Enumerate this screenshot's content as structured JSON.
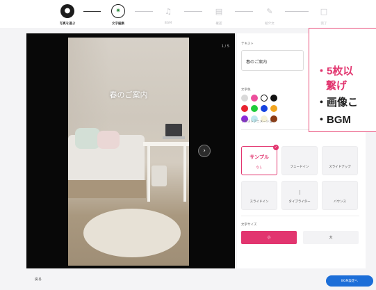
{
  "stepper": {
    "steps": [
      {
        "label": "写真を選ぶ",
        "icon": "camera-icon",
        "state": "done"
      },
      {
        "label": "文字編集",
        "icon": "text-edit-icon",
        "state": "current"
      },
      {
        "label": "BGM",
        "icon": "music-note-icon",
        "state": "todo"
      },
      {
        "label": "確認",
        "icon": "checklist-icon",
        "state": "todo"
      },
      {
        "label": "紹介文",
        "icon": "pen-icon",
        "state": "todo"
      },
      {
        "label": "完了",
        "icon": "document-icon",
        "state": "todo"
      }
    ]
  },
  "preview": {
    "overlay_title": "春のご案内",
    "page_counter": "1 / 5"
  },
  "panel": {
    "text_label": "テキスト",
    "text_value": "春のご案内",
    "color_label": "文字色",
    "colors": [
      "#d9d9d9",
      "#ec4f9c",
      "#ffffff",
      "#111111",
      "#e8222f",
      "#1ecb3b",
      "#1543e0",
      "#f2a51e",
      "#8a2bd8",
      "#bfe9ef",
      "#f6f2d8",
      "#8b3a12"
    ],
    "selected_color": "#ffffff",
    "animation_label": "テキストアニメーション",
    "animations": [
      {
        "title": "サンプル",
        "sub": "なし",
        "selected": true
      },
      {
        "title": "フェードイン",
        "selected": false
      },
      {
        "title": "スライドアップ",
        "selected": false
      },
      {
        "title": "スライドイン",
        "selected": false
      },
      {
        "title": "タイプライター",
        "selected": false
      },
      {
        "title": "バウンス",
        "selected": false
      }
    ],
    "size_label": "文字サイズ",
    "size_small": "小",
    "size_large": "大"
  },
  "callout": {
    "line1": "・5枚以",
    "line2": "繋げ",
    "line3": "・画像こ",
    "line4": "・BGM"
  },
  "footer": {
    "back_label": "戻る",
    "next_label": "BGM設定へ"
  },
  "colors": {
    "accent": "#e2356f",
    "primary": "#1c6ed8",
    "dark": "#1c1c1c"
  }
}
